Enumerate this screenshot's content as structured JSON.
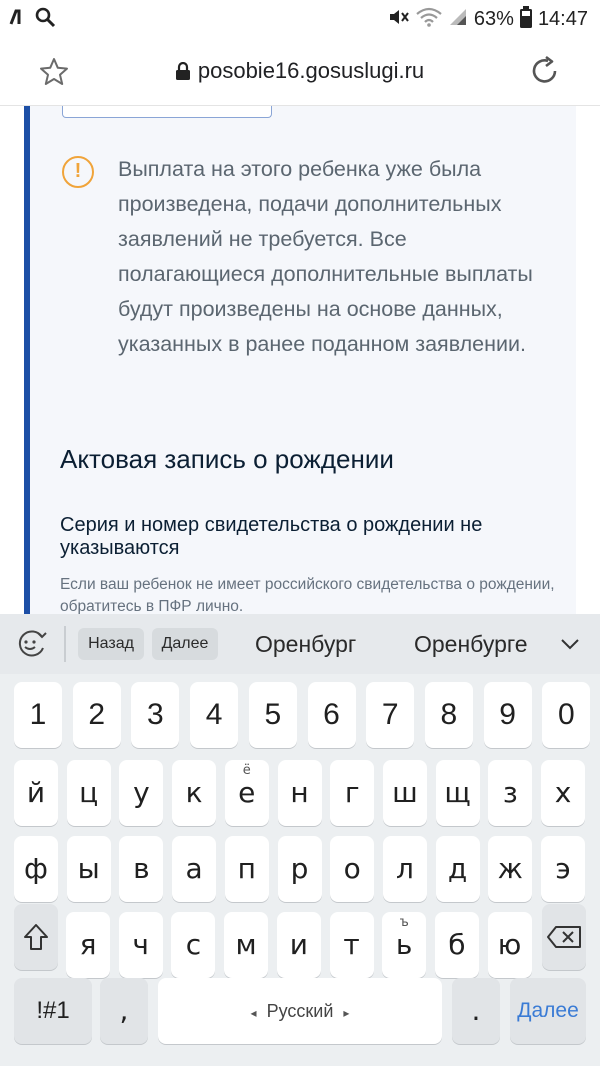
{
  "status_bar": {
    "left_icons": [
      "carrier-icon",
      "search-icon"
    ],
    "right_icons": [
      "mute-icon",
      "wifi-icon",
      "signal-icon",
      "battery-icon"
    ],
    "battery": "63%",
    "time": "14:47"
  },
  "browser": {
    "url": "posobie16.gosuslugi.ru"
  },
  "page": {
    "warning_text": "Выплата на этого ребенка уже была произведена, подачи дополнительных заявлений не требуется. Все полагающиеся дополнительные выплаты будут произведены на основе данных, указанных в ранее поданном заявлении.",
    "section_title": "Актовая запись о рождении",
    "field_title": "Серия и номер свидетельства о рождении не указываются",
    "field_hint": "Если ваш ребенок не имеет российского свидетельства о рождении, обратитесь в ПФР лично."
  },
  "keyboard": {
    "chip_back": "Назад",
    "chip_next": "Далее",
    "suggestion_1": "Оренбург",
    "suggestion_2": "Оренбурге",
    "row_numbers": [
      "1",
      "2",
      "3",
      "4",
      "5",
      "6",
      "7",
      "8",
      "9",
      "0"
    ],
    "row1": [
      "й",
      "ц",
      "у",
      "к",
      "е",
      "н",
      "г",
      "ш",
      "щ",
      "з",
      "х"
    ],
    "row1_alt": {
      "4": "ё"
    },
    "row2": [
      "ф",
      "ы",
      "в",
      "а",
      "п",
      "р",
      "о",
      "л",
      "д",
      "ж",
      "э"
    ],
    "row3": [
      "я",
      "ч",
      "с",
      "м",
      "и",
      "т",
      "ь",
      "б",
      "ю"
    ],
    "row3_alt": {
      "6": "ъ"
    },
    "symbols_key": "!#1",
    "comma_key": ",",
    "space_label": "Русский",
    "period_key": ".",
    "enter_label": "Далее"
  },
  "colors": {
    "accent_border": "#1d4fa6",
    "warning": "#f0a43a",
    "enter_key_text": "#3a7bd5"
  }
}
